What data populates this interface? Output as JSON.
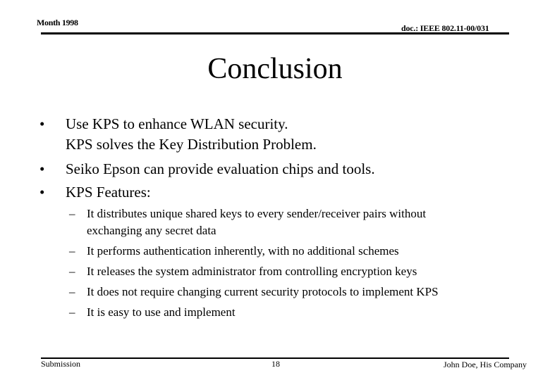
{
  "header": {
    "date": "Month 1998",
    "doc_id": "doc.: IEEE 802.11-00/031"
  },
  "slide": {
    "title": "Conclusion",
    "bullets": [
      {
        "marker": "•",
        "lines": [
          "Use KPS to enhance WLAN security.",
          "KPS solves the Key Distribution Problem."
        ]
      },
      {
        "marker": "•",
        "lines": [
          "Seiko Epson can provide evaluation chips and tools."
        ]
      },
      {
        "marker": "•",
        "lines": [
          "KPS Features:"
        ]
      }
    ],
    "sub_bullets": [
      {
        "marker": "–",
        "lines": [
          "It distributes unique shared keys to every sender/receiver pairs without",
          "exchanging any secret data"
        ]
      },
      {
        "marker": "–",
        "lines": [
          "It performs authentication inherently, with no additional schemes"
        ]
      },
      {
        "marker": "–",
        "lines": [
          "It releases the system administrator from controlling encryption keys"
        ]
      },
      {
        "marker": "–",
        "lines": [
          "It does not require changing current security protocols to implement KPS"
        ]
      },
      {
        "marker": "–",
        "lines": [
          "It is easy to use and implement"
        ]
      }
    ]
  },
  "footer": {
    "left": "Submission",
    "page_number": "18",
    "right": "John Doe, His Company"
  }
}
